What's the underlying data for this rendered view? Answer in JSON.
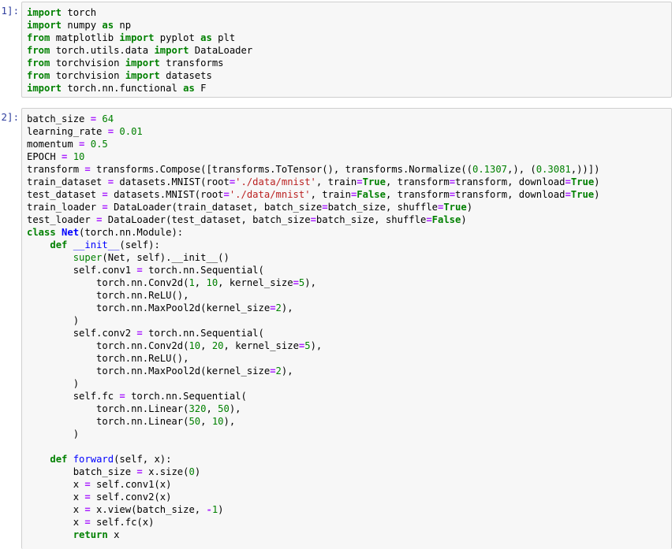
{
  "cells": [
    {
      "prompt": "[1]:",
      "lines": [
        [
          {
            "t": "import",
            "k": "kw"
          },
          {
            "t": " torch",
            "k": "plain"
          }
        ],
        [
          {
            "t": "import",
            "k": "kw"
          },
          {
            "t": " numpy ",
            "k": "plain"
          },
          {
            "t": "as",
            "k": "kw"
          },
          {
            "t": " np",
            "k": "plain"
          }
        ],
        [
          {
            "t": "from",
            "k": "kw"
          },
          {
            "t": " matplotlib ",
            "k": "plain"
          },
          {
            "t": "import",
            "k": "kw"
          },
          {
            "t": " pyplot ",
            "k": "plain"
          },
          {
            "t": "as",
            "k": "kw"
          },
          {
            "t": " plt",
            "k": "plain"
          }
        ],
        [
          {
            "t": "from",
            "k": "kw"
          },
          {
            "t": " torch.utils.data ",
            "k": "plain"
          },
          {
            "t": "import",
            "k": "kw"
          },
          {
            "t": " DataLoader",
            "k": "plain"
          }
        ],
        [
          {
            "t": "from",
            "k": "kw"
          },
          {
            "t": " torchvision ",
            "k": "plain"
          },
          {
            "t": "import",
            "k": "kw"
          },
          {
            "t": " transforms",
            "k": "plain"
          }
        ],
        [
          {
            "t": "from",
            "k": "kw"
          },
          {
            "t": " torchvision ",
            "k": "plain"
          },
          {
            "t": "import",
            "k": "kw"
          },
          {
            "t": " datasets",
            "k": "plain"
          }
        ],
        [
          {
            "t": "import",
            "k": "kw"
          },
          {
            "t": " torch.nn.functional ",
            "k": "plain"
          },
          {
            "t": "as",
            "k": "kw"
          },
          {
            "t": " F",
            "k": "plain"
          }
        ]
      ]
    },
    {
      "prompt": "[2]:",
      "lines": [
        [
          {
            "t": "batch_size ",
            "k": "plain"
          },
          {
            "t": "=",
            "k": "op"
          },
          {
            "t": " ",
            "k": "plain"
          },
          {
            "t": "64",
            "k": "num"
          }
        ],
        [
          {
            "t": "learning_rate ",
            "k": "plain"
          },
          {
            "t": "=",
            "k": "op"
          },
          {
            "t": " ",
            "k": "plain"
          },
          {
            "t": "0.01",
            "k": "num"
          }
        ],
        [
          {
            "t": "momentum ",
            "k": "plain"
          },
          {
            "t": "=",
            "k": "op"
          },
          {
            "t": " ",
            "k": "plain"
          },
          {
            "t": "0.5",
            "k": "num"
          }
        ],
        [
          {
            "t": "EPOCH ",
            "k": "plain"
          },
          {
            "t": "=",
            "k": "op"
          },
          {
            "t": " ",
            "k": "plain"
          },
          {
            "t": "10",
            "k": "num"
          }
        ],
        [
          {
            "t": "transform ",
            "k": "plain"
          },
          {
            "t": "=",
            "k": "op"
          },
          {
            "t": " transforms.Compose([transforms.ToTensor(), transforms.Normalize((",
            "k": "plain"
          },
          {
            "t": "0.1307",
            "k": "num"
          },
          {
            "t": ",), (",
            "k": "plain"
          },
          {
            "t": "0.3081",
            "k": "num"
          },
          {
            "t": ",))])",
            "k": "plain"
          }
        ],
        [
          {
            "t": "train_dataset ",
            "k": "plain"
          },
          {
            "t": "=",
            "k": "op"
          },
          {
            "t": " datasets.MNIST(root",
            "k": "plain"
          },
          {
            "t": "=",
            "k": "op"
          },
          {
            "t": "'./data/mnist'",
            "k": "str"
          },
          {
            "t": ", train",
            "k": "plain"
          },
          {
            "t": "=",
            "k": "op"
          },
          {
            "t": "True",
            "k": "kw"
          },
          {
            "t": ", transform",
            "k": "plain"
          },
          {
            "t": "=",
            "k": "op"
          },
          {
            "t": "transform, download",
            "k": "plain"
          },
          {
            "t": "=",
            "k": "op"
          },
          {
            "t": "True",
            "k": "kw"
          },
          {
            "t": ")",
            "k": "plain"
          }
        ],
        [
          {
            "t": "test_dataset ",
            "k": "plain"
          },
          {
            "t": "=",
            "k": "op"
          },
          {
            "t": " datasets.MNIST(root",
            "k": "plain"
          },
          {
            "t": "=",
            "k": "op"
          },
          {
            "t": "'./data/mnist'",
            "k": "str"
          },
          {
            "t": ", train",
            "k": "plain"
          },
          {
            "t": "=",
            "k": "op"
          },
          {
            "t": "False",
            "k": "kw"
          },
          {
            "t": ", transform",
            "k": "plain"
          },
          {
            "t": "=",
            "k": "op"
          },
          {
            "t": "transform, download",
            "k": "plain"
          },
          {
            "t": "=",
            "k": "op"
          },
          {
            "t": "True",
            "k": "kw"
          },
          {
            "t": ")",
            "k": "plain"
          }
        ],
        [
          {
            "t": "train_loader ",
            "k": "plain"
          },
          {
            "t": "=",
            "k": "op"
          },
          {
            "t": " DataLoader(train_dataset, batch_size",
            "k": "plain"
          },
          {
            "t": "=",
            "k": "op"
          },
          {
            "t": "batch_size, shuffle",
            "k": "plain"
          },
          {
            "t": "=",
            "k": "op"
          },
          {
            "t": "True",
            "k": "kw"
          },
          {
            "t": ")",
            "k": "plain"
          }
        ],
        [
          {
            "t": "test_loader ",
            "k": "plain"
          },
          {
            "t": "=",
            "k": "op"
          },
          {
            "t": " DataLoader(test_dataset, batch_size",
            "k": "plain"
          },
          {
            "t": "=",
            "k": "op"
          },
          {
            "t": "batch_size, shuffle",
            "k": "plain"
          },
          {
            "t": "=",
            "k": "op"
          },
          {
            "t": "False",
            "k": "kw"
          },
          {
            "t": ")",
            "k": "plain"
          }
        ],
        [
          {
            "t": "class",
            "k": "kw"
          },
          {
            "t": " ",
            "k": "plain"
          },
          {
            "t": "Net",
            "k": "cls"
          },
          {
            "t": "(torch.nn.Module):",
            "k": "plain"
          }
        ],
        [
          {
            "t": "    ",
            "k": "plain"
          },
          {
            "t": "def",
            "k": "kw"
          },
          {
            "t": " ",
            "k": "plain"
          },
          {
            "t": "__init__",
            "k": "def"
          },
          {
            "t": "(self):",
            "k": "plain"
          }
        ],
        [
          {
            "t": "        ",
            "k": "plain"
          },
          {
            "t": "super",
            "k": "builtin"
          },
          {
            "t": "(Net, self).__init__()",
            "k": "plain"
          }
        ],
        [
          {
            "t": "        self.conv1 ",
            "k": "plain"
          },
          {
            "t": "=",
            "k": "op"
          },
          {
            "t": " torch.nn.Sequential(",
            "k": "plain"
          }
        ],
        [
          {
            "t": "            torch.nn.Conv2d(",
            "k": "plain"
          },
          {
            "t": "1",
            "k": "num"
          },
          {
            "t": ", ",
            "k": "plain"
          },
          {
            "t": "10",
            "k": "num"
          },
          {
            "t": ", kernel_size",
            "k": "plain"
          },
          {
            "t": "=",
            "k": "op"
          },
          {
            "t": "5",
            "k": "num"
          },
          {
            "t": "),",
            "k": "plain"
          }
        ],
        [
          {
            "t": "            torch.nn.ReLU(),",
            "k": "plain"
          }
        ],
        [
          {
            "t": "            torch.nn.MaxPool2d(kernel_size",
            "k": "plain"
          },
          {
            "t": "=",
            "k": "op"
          },
          {
            "t": "2",
            "k": "num"
          },
          {
            "t": "),",
            "k": "plain"
          }
        ],
        [
          {
            "t": "        )",
            "k": "plain"
          }
        ],
        [
          {
            "t": "        self.conv2 ",
            "k": "plain"
          },
          {
            "t": "=",
            "k": "op"
          },
          {
            "t": " torch.nn.Sequential(",
            "k": "plain"
          }
        ],
        [
          {
            "t": "            torch.nn.Conv2d(",
            "k": "plain"
          },
          {
            "t": "10",
            "k": "num"
          },
          {
            "t": ", ",
            "k": "plain"
          },
          {
            "t": "20",
            "k": "num"
          },
          {
            "t": ", kernel_size",
            "k": "plain"
          },
          {
            "t": "=",
            "k": "op"
          },
          {
            "t": "5",
            "k": "num"
          },
          {
            "t": "),",
            "k": "plain"
          }
        ],
        [
          {
            "t": "            torch.nn.ReLU(),",
            "k": "plain"
          }
        ],
        [
          {
            "t": "            torch.nn.MaxPool2d(kernel_size",
            "k": "plain"
          },
          {
            "t": "=",
            "k": "op"
          },
          {
            "t": "2",
            "k": "num"
          },
          {
            "t": "),",
            "k": "plain"
          }
        ],
        [
          {
            "t": "        )",
            "k": "plain"
          }
        ],
        [
          {
            "t": "        self.fc ",
            "k": "plain"
          },
          {
            "t": "=",
            "k": "op"
          },
          {
            "t": " torch.nn.Sequential(",
            "k": "plain"
          }
        ],
        [
          {
            "t": "            torch.nn.Linear(",
            "k": "plain"
          },
          {
            "t": "320",
            "k": "num"
          },
          {
            "t": ", ",
            "k": "plain"
          },
          {
            "t": "50",
            "k": "num"
          },
          {
            "t": "),",
            "k": "plain"
          }
        ],
        [
          {
            "t": "            torch.nn.Linear(",
            "k": "plain"
          },
          {
            "t": "50",
            "k": "num"
          },
          {
            "t": ", ",
            "k": "plain"
          },
          {
            "t": "10",
            "k": "num"
          },
          {
            "t": "),",
            "k": "plain"
          }
        ],
        [
          {
            "t": "        )",
            "k": "plain"
          }
        ],
        [
          {
            "t": "",
            "k": "plain"
          }
        ],
        [
          {
            "t": "    ",
            "k": "plain"
          },
          {
            "t": "def",
            "k": "kw"
          },
          {
            "t": " ",
            "k": "plain"
          },
          {
            "t": "forward",
            "k": "def"
          },
          {
            "t": "(self, x):",
            "k": "plain"
          }
        ],
        [
          {
            "t": "        batch_size ",
            "k": "plain"
          },
          {
            "t": "=",
            "k": "op"
          },
          {
            "t": " x.size(",
            "k": "plain"
          },
          {
            "t": "0",
            "k": "num"
          },
          {
            "t": ")",
            "k": "plain"
          }
        ],
        [
          {
            "t": "        x ",
            "k": "plain"
          },
          {
            "t": "=",
            "k": "op"
          },
          {
            "t": " self.conv1(x)",
            "k": "plain"
          }
        ],
        [
          {
            "t": "        x ",
            "k": "plain"
          },
          {
            "t": "=",
            "k": "op"
          },
          {
            "t": " self.conv2(x)",
            "k": "plain"
          }
        ],
        [
          {
            "t": "        x ",
            "k": "plain"
          },
          {
            "t": "=",
            "k": "op"
          },
          {
            "t": " x.view(batch_size, ",
            "k": "plain"
          },
          {
            "t": "-",
            "k": "op"
          },
          {
            "t": "1",
            "k": "num"
          },
          {
            "t": ")",
            "k": "plain"
          }
        ],
        [
          {
            "t": "        x ",
            "k": "plain"
          },
          {
            "t": "=",
            "k": "op"
          },
          {
            "t": " self.fc(x)",
            "k": "plain"
          }
        ],
        [
          {
            "t": "        ",
            "k": "plain"
          },
          {
            "t": "return",
            "k": "kw"
          },
          {
            "t": " x",
            "k": "plain"
          }
        ]
      ]
    }
  ]
}
